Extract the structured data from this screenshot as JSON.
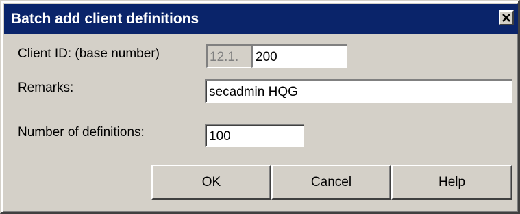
{
  "dialog": {
    "title": "Batch add client definitions",
    "close_icon": "close-icon",
    "title_bar_color": "#0a246a",
    "face_color": "#d4d0c8"
  },
  "form": {
    "client_id": {
      "label": "Client ID: (base number)",
      "prefix": "12.1.",
      "value": "200"
    },
    "remarks": {
      "label": "Remarks:",
      "value": "secadmin HQG"
    },
    "number_of_definitions": {
      "label": "Number of definitions:",
      "value": "100"
    }
  },
  "buttons": {
    "ok": "OK",
    "cancel": "Cancel",
    "help_mnemonic": "H",
    "help_rest": "elp"
  }
}
